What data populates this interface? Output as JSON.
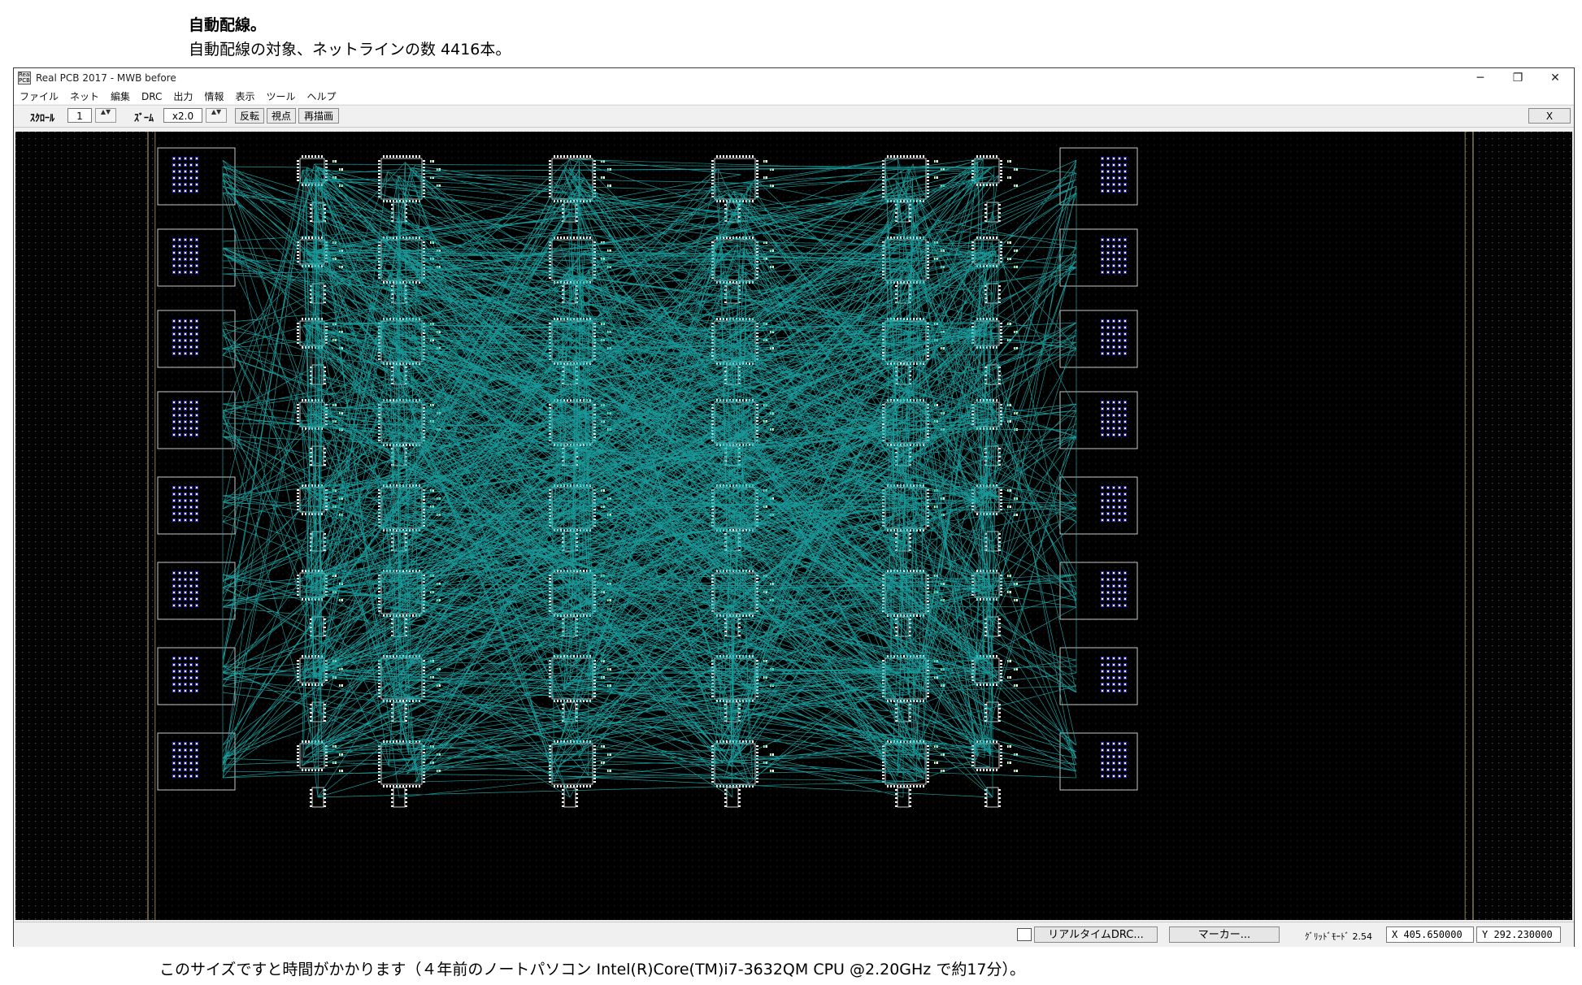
{
  "doc": {
    "heading": "自動配線。",
    "subheading": "自動配線の対象、ネットラインの数 4416本。",
    "caption": "このサイズですと時間がかかります（４年前のノートパソコン Intel(R)Core(TM)i7-3632QM CPU @2.20GHz で約17分）。"
  },
  "window": {
    "title": "Real PCB 2017 - MWB before",
    "icon_text": "Real PCB",
    "controls": {
      "minimize": "─",
      "maximize": "❐",
      "close": "✕"
    }
  },
  "menu": [
    "ファイル",
    "ネット",
    "編集",
    "DRC",
    "出力",
    "情報",
    "表示",
    "ツール",
    "ヘルプ"
  ],
  "toolbar": {
    "scroll_label": "ｽｸﾛｰﾙ",
    "scroll_value": "1",
    "zoom_label": "ｽﾞｰﾑ",
    "zoom_value": "x2.0",
    "spin_glyph": "▲▼",
    "flip_label": "反転",
    "view_label": "視点",
    "redraw_label": "再描画",
    "close_label": "X"
  },
  "status": {
    "drc_label": "リアルタイムDRC...",
    "marker_label": "マーカー...",
    "grid_label": "ｸﾞﾘｯﾄﾞﾓｰﾄﾞ 2.54",
    "x_coord": "X 405.650000",
    "y_coord": "Y 292.230000"
  },
  "colors": {
    "board_bg": "#000000",
    "ratsnest": "#1fb3b3",
    "pad": "#ffffff",
    "connector_pad": "#3333cc",
    "outline": "#c8c8c8"
  }
}
